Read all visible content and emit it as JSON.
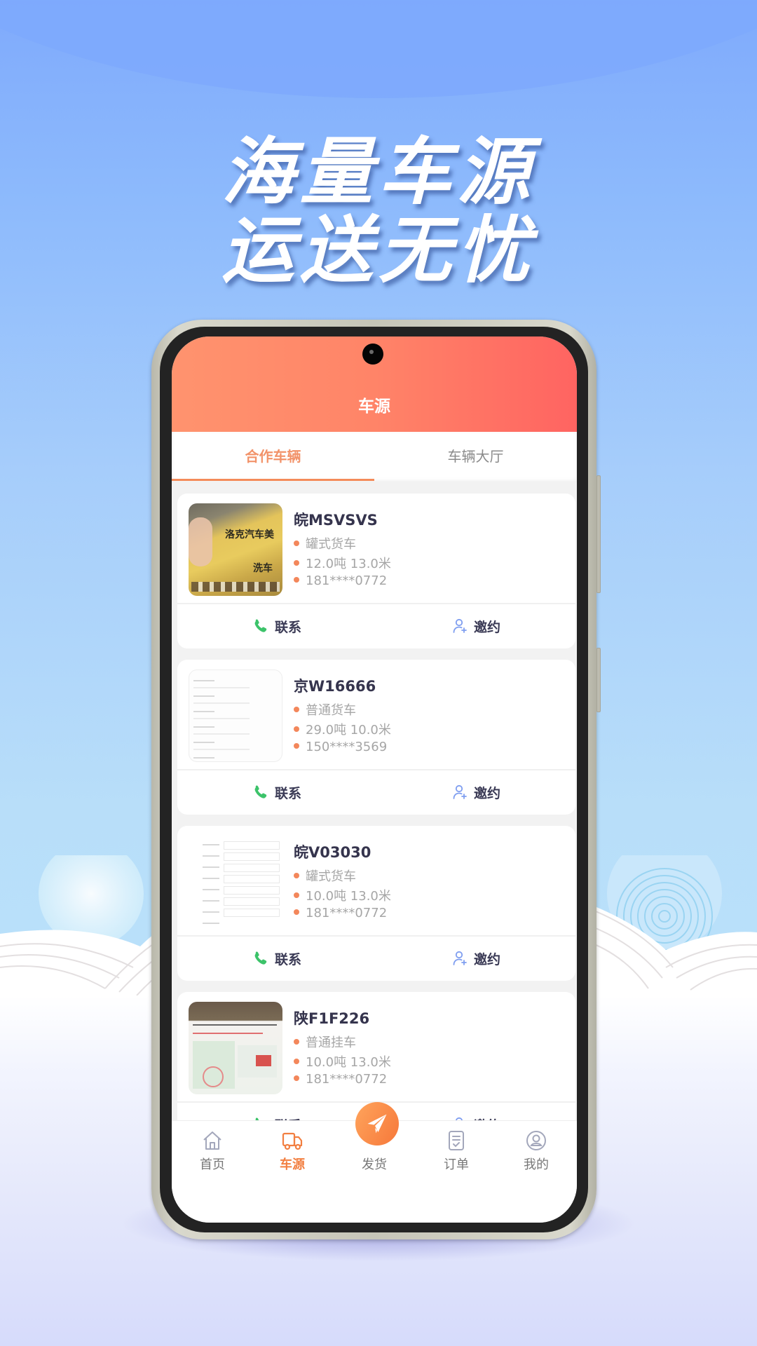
{
  "headline": {
    "line1": "海量车源",
    "line2": "运送无忧"
  },
  "app": {
    "title": "车源",
    "tabs": [
      {
        "label": "合作车辆",
        "active": true
      },
      {
        "label": "车辆大厅",
        "active": false
      }
    ],
    "vehicles": [
      {
        "plate": "皖MSVSVS",
        "type": "罐式货车",
        "spec": "12.0吨 13.0米",
        "phone": "181****0772",
        "thumb_text_1": "洛克汽车美",
        "thumb_text_2": "洗车"
      },
      {
        "plate": "京W16666",
        "type": "普通货车",
        "spec": "29.0吨 10.0米",
        "phone": "150****3569"
      },
      {
        "plate": "皖V03030",
        "type": "罐式货车",
        "spec": "10.0吨 13.0米",
        "phone": "181****0772"
      },
      {
        "plate": "陕F1F226",
        "type": "普通挂车",
        "spec": "10.0吨 13.0米",
        "phone": "181****0772"
      }
    ],
    "actions": {
      "contact": "联系",
      "invite": "邀约"
    },
    "bottom_nav": [
      {
        "label": "首页",
        "icon": "home-icon",
        "active": false
      },
      {
        "label": "车源",
        "icon": "truck-icon",
        "active": true
      },
      {
        "label": "发货",
        "icon": "paper-plane-icon",
        "active": false
      },
      {
        "label": "订单",
        "icon": "order-icon",
        "active": false
      },
      {
        "label": "我的",
        "icon": "profile-icon",
        "active": false
      }
    ]
  },
  "colors": {
    "accent": "#f48b5a",
    "header_start": "#ff936e",
    "header_end": "#ff6461",
    "contact_green": "#3cc36a",
    "invite_blue": "#7f9ef0",
    "nav_active": "#f27f41"
  }
}
